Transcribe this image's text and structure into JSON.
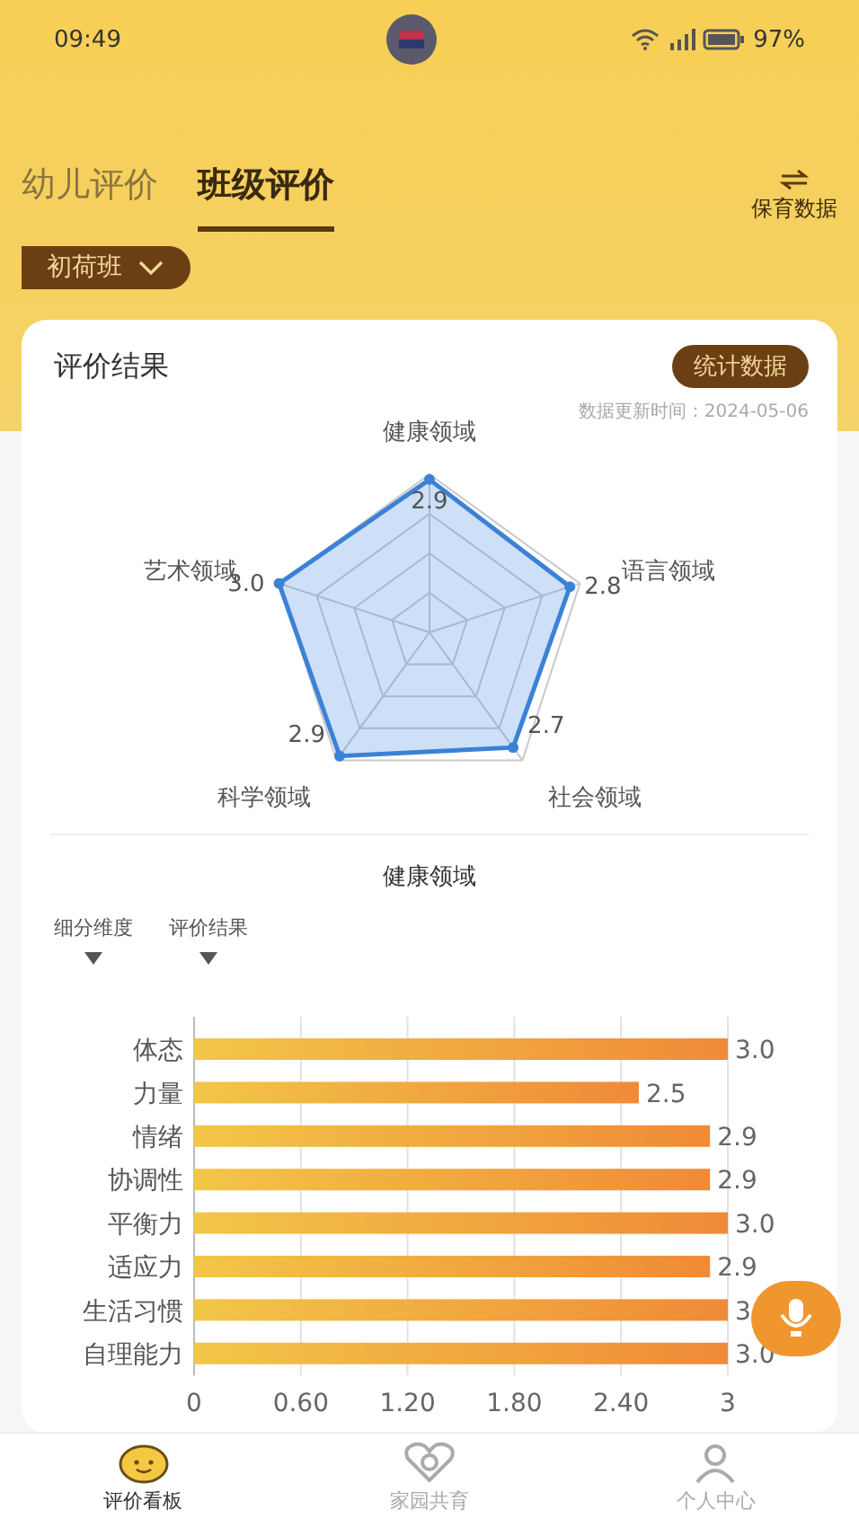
{
  "status_bar": {
    "time": "09:49",
    "battery": "97%"
  },
  "tabs": [
    {
      "label": "幼儿评价",
      "selected": false
    },
    {
      "label": "班级评价",
      "selected": true
    }
  ],
  "header_action": {
    "label": "保育数据"
  },
  "class_selector": {
    "value": "初荷班"
  },
  "result_card": {
    "title": "评价结果",
    "button": "统计数据",
    "updated": "数据更新时间：2024-05-06",
    "radar": [
      {
        "label": "健康领域",
        "value": "2.9"
      },
      {
        "label": "艺术领域",
        "value": "3.0"
      },
      {
        "label": "语言领域",
        "value": "2.8"
      },
      {
        "label": "科学领域",
        "value": "2.9"
      },
      {
        "label": "社会领域",
        "value": "2.7"
      }
    ]
  },
  "detail": {
    "title": "健康领域",
    "filters": [
      {
        "label": "细分维度"
      },
      {
        "label": "评价结果"
      }
    ],
    "chart_data": {
      "type": "bar",
      "orientation": "horizontal",
      "categories": [
        "体态",
        "力量",
        "情绪",
        "协调性",
        "平衡力",
        "适应力",
        "生活习惯",
        "自理能力"
      ],
      "values": [
        3.0,
        2.5,
        2.9,
        2.9,
        3.0,
        2.9,
        3.0,
        3.0
      ],
      "value_labels": [
        "3.0",
        "2.5",
        "2.9",
        "2.9",
        "3.0",
        "2.9",
        "3",
        "3.0"
      ],
      "xlim": [
        0,
        3
      ],
      "grid": true,
      "xticks": [
        {
          "value": 0,
          "label": "0"
        },
        {
          "value": 0.6,
          "label": "0.60"
        },
        {
          "value": 1.2,
          "label": "1.20"
        },
        {
          "value": 1.8,
          "label": "1.80"
        },
        {
          "value": 2.4,
          "label": "2.40"
        },
        {
          "value": 3,
          "label": "3"
        }
      ]
    }
  },
  "bottom_nav": [
    {
      "label": "评价看板",
      "selected": true,
      "kind": "face"
    },
    {
      "label": "家园共育",
      "selected": false,
      "kind": "heart"
    },
    {
      "label": "个人中心",
      "selected": false,
      "kind": "person"
    }
  ]
}
